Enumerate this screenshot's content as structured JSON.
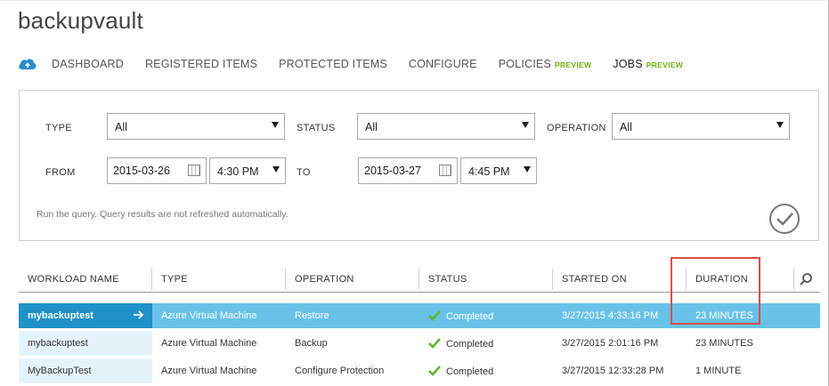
{
  "window": {
    "title": "backupvault"
  },
  "nav": {
    "items": [
      {
        "label": "DASHBOARD",
        "badge": ""
      },
      {
        "label": "REGISTERED ITEMS",
        "badge": ""
      },
      {
        "label": "PROTECTED ITEMS",
        "badge": ""
      },
      {
        "label": "CONFIGURE",
        "badge": ""
      },
      {
        "label": "POLICIES",
        "badge": "PREVIEW"
      },
      {
        "label": "JOBS",
        "badge": "PREVIEW",
        "active": true
      }
    ]
  },
  "filters": {
    "type_label": "TYPE",
    "type_value": "All",
    "status_label": "STATUS",
    "status_value": "All",
    "operation_label": "OPERATION",
    "operation_value": "All",
    "from_label": "FROM",
    "from_date": "2015-03-26",
    "from_time": "4:30 PM",
    "to_label": "TO",
    "to_date": "2015-03-27",
    "to_time": "4:45 PM",
    "hint": "Run the query. Query results are not refreshed automatically."
  },
  "grid": {
    "columns": [
      "WORKLOAD NAME",
      "TYPE",
      "OPERATION",
      "STATUS",
      "STARTED ON",
      "DURATION"
    ],
    "rows": [
      {
        "name": "mybackuptest",
        "type": "Azure Virtual Machine",
        "operation": "Restore",
        "status": "Completed",
        "started": "3/27/2015 4:33:16 PM",
        "duration": "23 MINUTES",
        "selected": true
      },
      {
        "name": "mybackuptest",
        "type": "Azure Virtual Machine",
        "operation": "Backup",
        "status": "Completed",
        "started": "3/27/2015 2:01:16 PM",
        "duration": "23 MINUTES"
      },
      {
        "name": "MyBackupTest",
        "type": "Azure Virtual Machine",
        "operation": "Configure Protection",
        "status": "Completed",
        "started": "3/27/2015 12:33:28 PM",
        "duration": "1 MINUTE"
      }
    ]
  },
  "colors": {
    "accent": "#1e91c8",
    "selected_row": "#68c2e8",
    "success": "#5cb82b",
    "preview": "#6fb10a",
    "highlight": "#d9504a"
  },
  "icons": {
    "brand": "backup-cloud-icon",
    "calendar": "calendar-icon",
    "run": "check-circle-icon",
    "search": "search-icon",
    "row_go": "arrow-right-icon",
    "status": "check-icon"
  }
}
